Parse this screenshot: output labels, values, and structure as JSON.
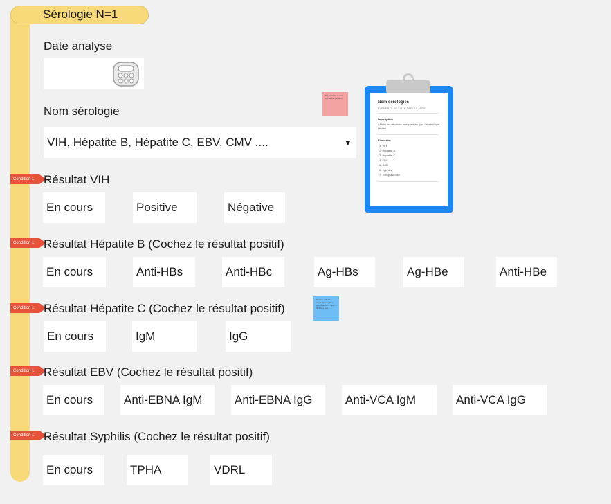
{
  "title": "Sérologie N=1",
  "date_field": {
    "label": "Date analyse",
    "value": ""
  },
  "nom_serologie": {
    "label": "Nom sérologie",
    "value": "VIH, Hépatite B, Hépatite C, EBV, CMV ....",
    "arrow": "▼"
  },
  "condition_tag": "Condition 1",
  "vih": {
    "label": "Résultat VIH",
    "options": [
      "En cours",
      "Positive",
      "Négative"
    ]
  },
  "hepb": {
    "label": "Résultat Hépatite B (Cochez le résultat positif)",
    "options": [
      "En cours",
      "Anti-HBs",
      "Anti-HBc",
      "Ag-HBs",
      "Ag-HBe",
      "Anti-HBe"
    ]
  },
  "hepc": {
    "label": "Résultat Hépatite C (Cochez le résultat positif)",
    "options": [
      "En cours",
      "IgM",
      "IgG"
    ]
  },
  "ebv": {
    "label": "Résultat EBV (Cochez le résultat positif)",
    "options": [
      "En cours",
      "Anti-EBNA IgM",
      "Anti-EBNA IgG",
      "Anti-VCA IgM",
      "Anti-VCA IgG"
    ]
  },
  "syphilis": {
    "label": "Résultat Syphilis (Cochez le résultat positif)",
    "options": [
      "En cours",
      "TPHA",
      "VDRL"
    ]
  },
  "sticky_pink": {
    "text": "Widget sticker / note non-verbal element",
    "color": "#f4a3a3"
  },
  "sticky_blue": {
    "text": "Similarly will note output item for this type, options — IgM — Inhibitory test",
    "color": "#6fbdf5"
  },
  "clipboard": {
    "title": "Nom sérologies",
    "subtitle": "ÉLÉMENTS DE LISTE DÉROULANTE",
    "description_heading": "Description",
    "description": "Affiche les résultats adéquats au type de sérologie choisie",
    "elements_heading": "Éléments:",
    "items": [
      "1. VIH",
      "2. Hépatite B",
      "3. Hépatite C",
      "4. EBV",
      "5. CMV",
      "6. Syphilis",
      "7. Toxoplasmose"
    ]
  }
}
